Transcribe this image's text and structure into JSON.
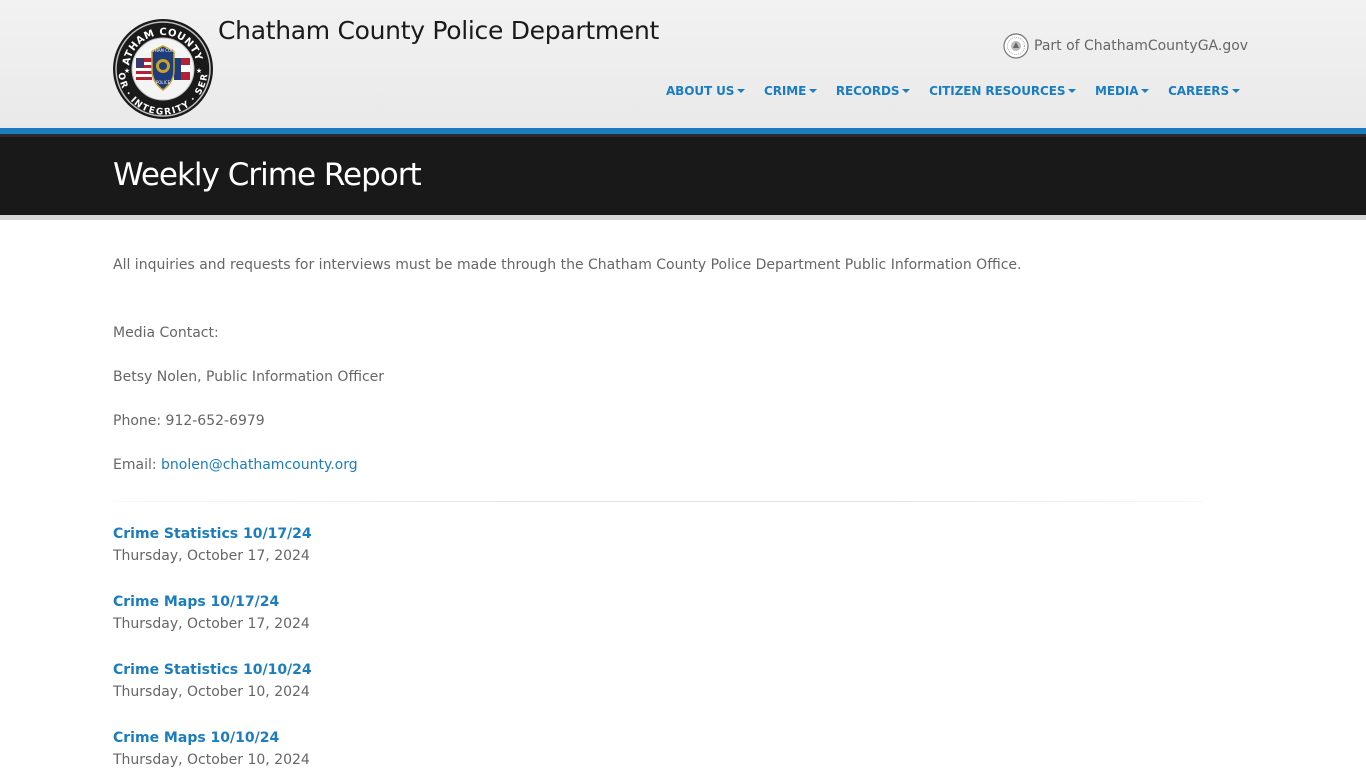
{
  "header": {
    "site_title": "Chatham County Police Department",
    "logo": {
      "icon": "police-badge-logo",
      "ring_text_top": "CHATHAM COUNTY GA",
      "ring_text_bottom": "HONOR · INTEGRITY · SERVICE",
      "inner_text_top": "CHATHAM COUNTY",
      "inner_text_bottom": "POLICE"
    },
    "county_link": {
      "label": "Part of ChathamCountyGA.gov",
      "icon": "county-seal-icon"
    },
    "nav": [
      {
        "label": "ABOUT US",
        "icon": "caret-down-icon"
      },
      {
        "label": "CRIME",
        "icon": "caret-down-icon"
      },
      {
        "label": "RECORDS",
        "icon": "caret-down-icon"
      },
      {
        "label": "CITIZEN RESOURCES",
        "icon": "caret-down-icon"
      },
      {
        "label": "MEDIA",
        "icon": "caret-down-icon"
      },
      {
        "label": "CAREERS",
        "icon": "caret-down-icon"
      }
    ]
  },
  "page": {
    "title": "Weekly Crime Report",
    "intro": "All inquiries and requests for interviews must be made through the Chatham County Police Department Public Information Office.",
    "media_contact_label": "Media Contact:",
    "contact_name": "Betsy Nolen, Public Information Officer",
    "phone": "Phone: 912-652-6979",
    "email_label": "Email: ",
    "email": "bnolen@chathamcounty.org"
  },
  "reports": [
    {
      "title": "Crime Statistics 10/17/24",
      "date": "Thursday, October 17, 2024"
    },
    {
      "title": "Crime Maps 10/17/24",
      "date": "Thursday, October 17, 2024"
    },
    {
      "title": "Crime Statistics 10/10/24",
      "date": "Thursday, October 10, 2024"
    },
    {
      "title": "Crime Maps 10/10/24",
      "date": "Thursday, October 10, 2024"
    }
  ],
  "colors": {
    "accent_blue": "#1b7dbf",
    "title_bar": "#191919",
    "header_bg": "#efefef",
    "body_text": "#666666"
  }
}
